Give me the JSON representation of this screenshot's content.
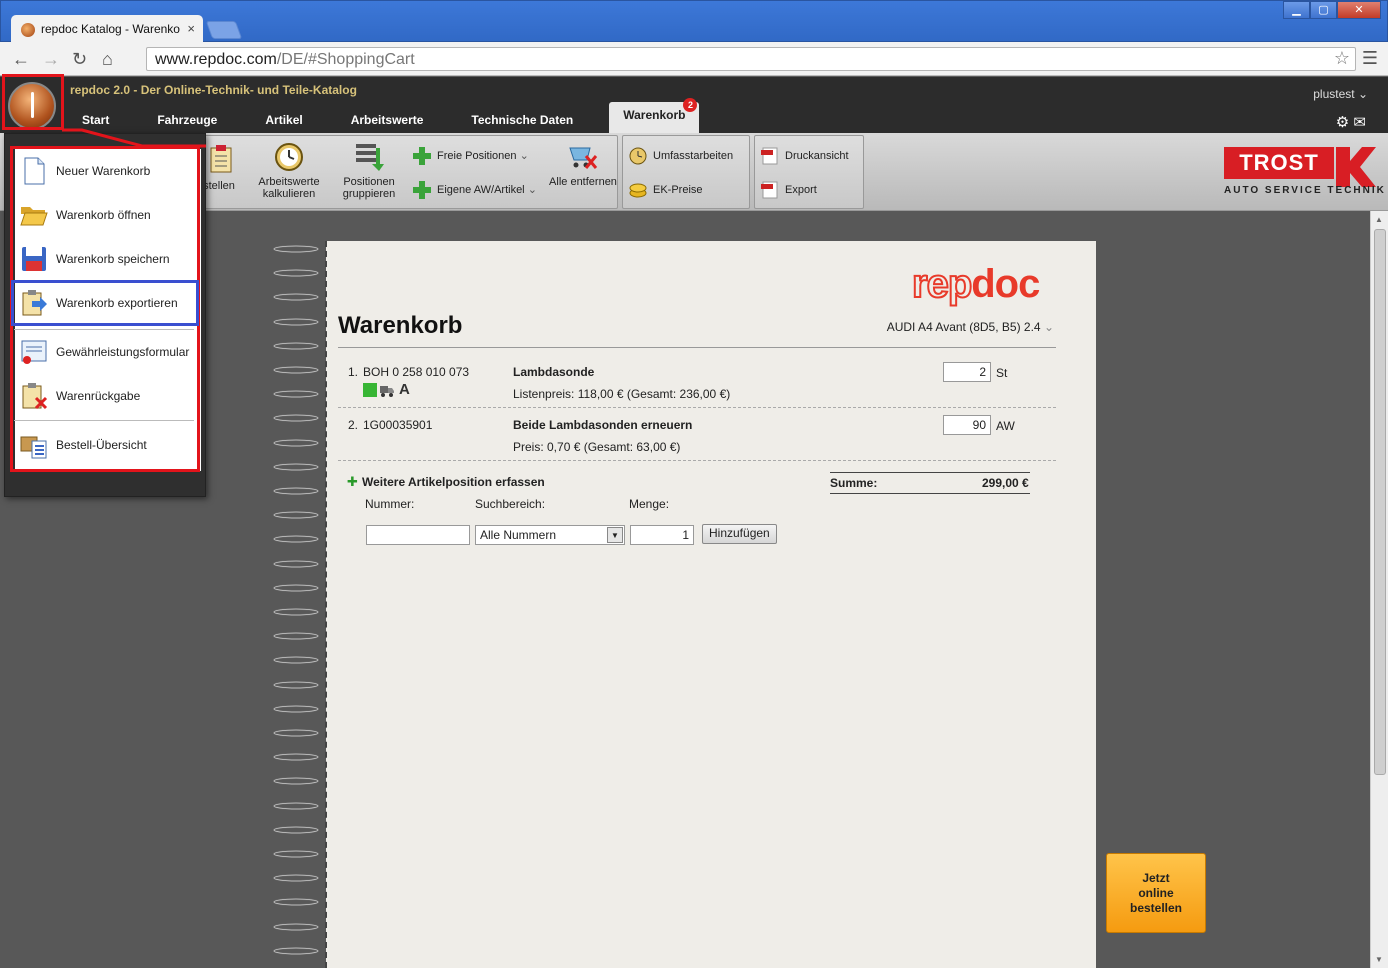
{
  "browser": {
    "tab_title": "repdoc Katalog - Warenko",
    "tab_close": "×",
    "url_host": "www.repdoc.com",
    "url_path": "/DE/#ShoppingCart",
    "win_min": "▁",
    "win_max": "▢",
    "win_close": "✕"
  },
  "app": {
    "title": "repdoc 2.0 - Der Online-Technik- und Teile-Katalog",
    "user": "plustest",
    "nav": [
      {
        "label": "Start"
      },
      {
        "label": "Fahrzeuge"
      },
      {
        "label": "Artikel"
      },
      {
        "label": "Arbeitswerte"
      },
      {
        "label": "Technische Daten"
      },
      {
        "label": "Warenkorb",
        "badge": "2"
      }
    ]
  },
  "toolbar": {
    "bestellen": "stellen",
    "arbeitswerte": "Arbeitswerte kalkulieren",
    "positionen": "Positionen gruppieren",
    "freie_positionen": "Freie Positionen",
    "eigene": "Eigene AW/Artikel",
    "alle_entfernen": "Alle entfernen",
    "umfassarbeiten": "Umfasstarbeiten",
    "ek_preise": "EK-Preise",
    "druckansicht": "Druckansicht",
    "export": "Export",
    "brand_name": "TROST",
    "brand_sub": "Auto Service Technik"
  },
  "menu": {
    "items": [
      {
        "label": "Neuer Warenkorb",
        "icon": "new-document-icon"
      },
      {
        "label": "Warenkorb öffnen",
        "icon": "folder-open-icon"
      },
      {
        "label": "Warenkorb speichern",
        "icon": "floppy-save-icon"
      },
      {
        "label": "Warenkorb exportieren",
        "icon": "export-icon"
      },
      {
        "label": "Gewährleistungsformular",
        "icon": "certificate-icon"
      },
      {
        "label": "Warenrückgabe",
        "icon": "return-icon"
      },
      {
        "label": "Bestell-Übersicht",
        "icon": "order-overview-icon"
      }
    ]
  },
  "cart": {
    "logo_rep": "rep",
    "logo_doc": "doc",
    "title": "Warenkorb",
    "vehicle": "AUDI A4 Avant (8D5, B5) 2.4",
    "positions": [
      {
        "num": "1.",
        "article": "BOH 0 258 010 073",
        "name": "Lambdasonde",
        "price": "Listenpreis: 118,00 € (Gesamt: 236,00 €)",
        "qty": "2",
        "unit": "St"
      },
      {
        "num": "2.",
        "article": "1G00035901",
        "name": "Beide Lambdasonden erneuern",
        "price": "Preis: 0,70 € (Gesamt: 63,00 €)",
        "qty": "90",
        "unit": "AW"
      }
    ],
    "add_title": "Weitere Artikelposition erfassen",
    "add_plus": "✚",
    "label_nummer": "Nummer:",
    "label_suchbereich": "Suchbereich:",
    "label_menge": "Menge:",
    "nummer_value": "",
    "suchbereich_value": "Alle Nummern",
    "menge_value": "1",
    "add_button": "Hinzufügen",
    "summe_label": "Summe:",
    "summe_value": "299,00 €"
  },
  "order_button": {
    "line1": "Jetzt",
    "line2": "online",
    "line3": "bestellen"
  },
  "colors": {
    "accent_red": "#e3141b",
    "highlight_blue": "#3a4fd0",
    "order_orange": "#f59b10"
  }
}
